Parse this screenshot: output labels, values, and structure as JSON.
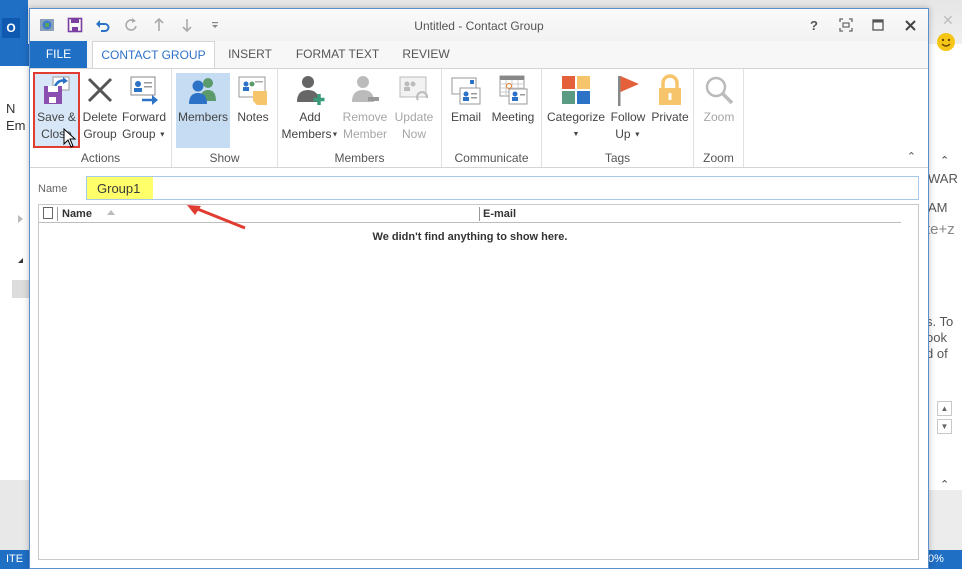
{
  "background_app": {
    "left_logo": "O",
    "left_snippet": [
      "N",
      "Em"
    ],
    "left_status": "ITE",
    "right_snippets": [
      "WAR",
      "AM",
      "te+z",
      "s. To",
      "ook",
      "d of"
    ],
    "right_status": "0%"
  },
  "window": {
    "title": "Untitled - Contact Group",
    "controls": {
      "help": "?",
      "restore": "restore-icon",
      "maximize": "maximize-icon",
      "close": "close-icon"
    },
    "quick_access": [
      "outlook-icon",
      "save-icon",
      "undo-icon",
      "redo-icon",
      "previous-item-icon",
      "next-item-icon",
      "customize-qat-icon"
    ]
  },
  "tabs": [
    {
      "label": "FILE"
    },
    {
      "label": "CONTACT GROUP",
      "active": true
    },
    {
      "label": "INSERT"
    },
    {
      "label": "FORMAT TEXT"
    },
    {
      "label": "REVIEW"
    }
  ],
  "ribbon": {
    "groups": [
      {
        "label": "Actions",
        "buttons": [
          {
            "line1": "Save &",
            "line2": "Close",
            "icon": "save-close-icon",
            "highlighted": true
          },
          {
            "line1": "Delete",
            "line2": "Group",
            "icon": "delete-icon"
          },
          {
            "line1": "Forward",
            "line2": "Group",
            "icon": "forward-group-icon",
            "dropdown": true
          }
        ]
      },
      {
        "label": "Show",
        "buttons": [
          {
            "line1": "Members",
            "line2": "",
            "icon": "members-icon",
            "selected": true
          },
          {
            "line1": "Notes",
            "line2": "",
            "icon": "notes-icon"
          }
        ]
      },
      {
        "label": "Members",
        "buttons": [
          {
            "line1": "Add",
            "line2": "Members",
            "icon": "add-member-icon",
            "dropdown": true
          },
          {
            "line1": "Remove",
            "line2": "Member",
            "icon": "remove-member-icon",
            "disabled": true
          },
          {
            "line1": "Update",
            "line2": "Now",
            "icon": "update-now-icon",
            "disabled": true
          }
        ]
      },
      {
        "label": "Communicate",
        "buttons": [
          {
            "line1": "Email",
            "line2": "",
            "icon": "email-icon"
          },
          {
            "line1": "Meeting",
            "line2": "",
            "icon": "meeting-icon"
          }
        ]
      },
      {
        "label": "Tags",
        "buttons": [
          {
            "line1": "Categorize",
            "line2": "",
            "icon": "categorize-icon",
            "dropdown": true
          },
          {
            "line1": "Follow",
            "line2": "Up",
            "icon": "flag-icon",
            "dropdown": true
          },
          {
            "line1": "Private",
            "line2": "",
            "icon": "lock-icon"
          }
        ]
      },
      {
        "label": "Zoom",
        "buttons": [
          {
            "line1": "Zoom",
            "line2": "",
            "icon": "zoom-icon",
            "disabled": true
          }
        ]
      }
    ]
  },
  "form": {
    "name_label": "Name",
    "name_value": "Group1"
  },
  "members_list": {
    "columns": [
      "Name",
      "E-mail"
    ],
    "sort_column": "Name",
    "sort_direction": "ascending",
    "rows": [],
    "empty_message": "We didn't find anything to show here."
  },
  "colors": {
    "accent": "#1f6fc5",
    "highlight": "#ffff6a",
    "annotation": "#e03c31",
    "selected": "#c5dcf2"
  }
}
